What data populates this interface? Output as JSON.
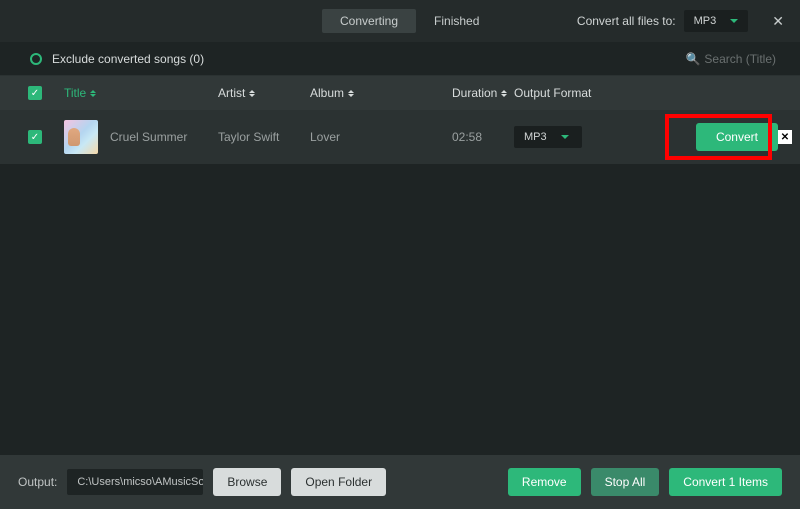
{
  "topbar": {
    "tabs": {
      "converting": "Converting",
      "finished": "Finished"
    },
    "convert_all_label": "Convert all files to:",
    "global_format": "MP3"
  },
  "subbar": {
    "exclude_label": "Exclude converted songs (0)",
    "search_placeholder": "Search  (Title)"
  },
  "columns": {
    "title": "Title",
    "artist": "Artist",
    "album": "Album",
    "duration": "Duration",
    "format": "Output Format"
  },
  "rows": [
    {
      "title": "Cruel Summer",
      "artist": "Taylor Swift",
      "album": "Lover",
      "duration": "02:58",
      "format": "MP3",
      "convert_label": "Convert"
    }
  ],
  "bottom": {
    "output_label": "Output:",
    "output_path": "C:\\Users\\micso\\AMusicSoft\\...",
    "browse": "Browse",
    "open_folder": "Open Folder",
    "remove": "Remove",
    "stop_all": "Stop All",
    "convert_items": "Convert 1 Items"
  }
}
